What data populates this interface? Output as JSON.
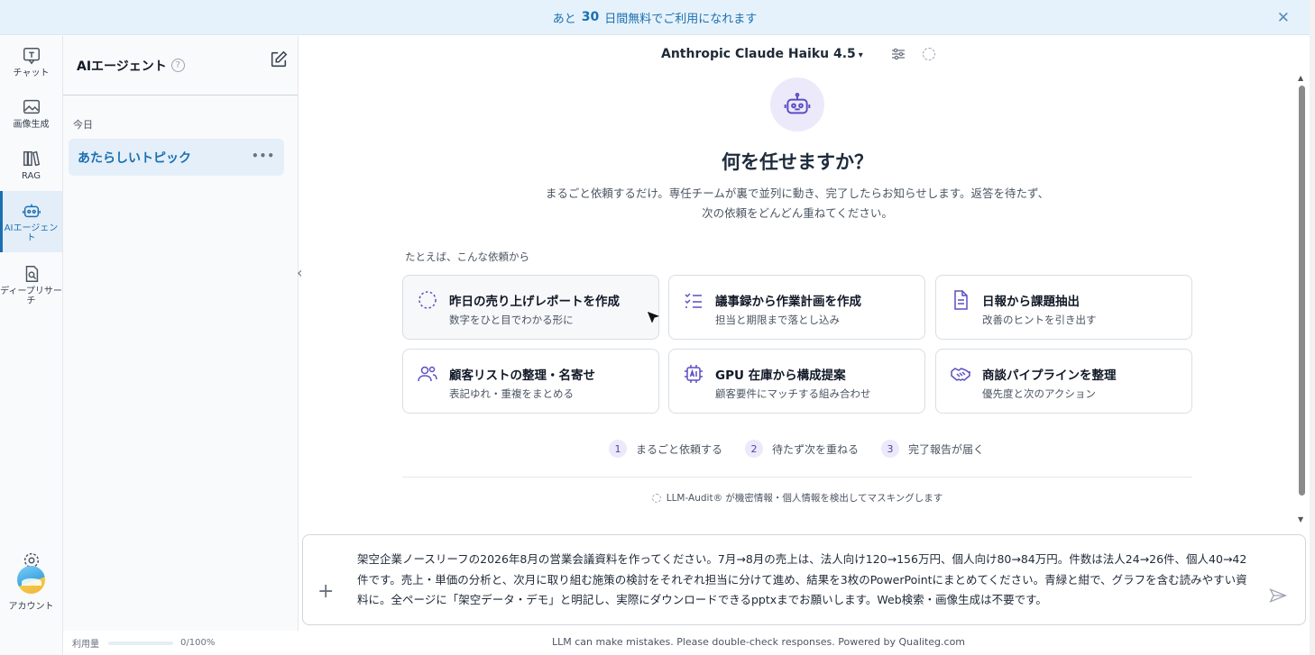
{
  "banner": {
    "prefix": "あと",
    "days": "30",
    "suffix": "日間無料でご利用になれます",
    "close": "✕"
  },
  "rail": {
    "items": [
      {
        "label": "チャット",
        "icon": "chat-icon"
      },
      {
        "label": "画像生成",
        "icon": "image-icon"
      },
      {
        "label": "RAG",
        "icon": "books-icon"
      },
      {
        "label": "AIエージェント",
        "icon": "robot-icon",
        "active": true
      },
      {
        "label": "ディープリサーチ",
        "icon": "doc-search-icon"
      }
    ],
    "settings_label": "設定",
    "account_label": "アカウント"
  },
  "sidebar": {
    "title": "AIエージェント",
    "help": "?",
    "section_today": "今日",
    "topics": [
      {
        "label": "あたらしいトピック",
        "menu": "•••"
      }
    ],
    "usage_label": "利用量",
    "usage_value": "0/100%"
  },
  "main": {
    "model_name": "Anthropic Claude Haiku 4.5",
    "caret": "▾",
    "hero_title": "何を任せますか？",
    "hero_subtitle": "まるごと依頼するだけ。専任チームが裏で並列に動き、完了したらお知らせします。返答を待たず、次の依頼をどんどん重ねてください。",
    "examples_label": "たとえば、こんな依頼から",
    "cards": [
      {
        "title": "昨日の売り上げレポートを作成",
        "subtitle": "数字をひと目でわかる形に",
        "icon": "loading-circle-icon"
      },
      {
        "title": "議事録から作業計画を作成",
        "subtitle": "担当と期限まで落とし込み",
        "icon": "checklist-icon"
      },
      {
        "title": "日報から課題抽出",
        "subtitle": "改善のヒントを引き出す",
        "icon": "document-icon"
      },
      {
        "title": "顧客リストの整理・名寄せ",
        "subtitle": "表記ゆれ・重複をまとめる",
        "icon": "users-icon"
      },
      {
        "title": "GPU 在庫から構成提案",
        "subtitle": "顧客要件にマッチする組み合わせ",
        "icon": "ai-chip-icon"
      },
      {
        "title": "商談パイプラインを整理",
        "subtitle": "優先度と次のアクション",
        "icon": "handshake-icon"
      }
    ],
    "steps": [
      {
        "num": "1",
        "label": "まるごと依頼する"
      },
      {
        "num": "2",
        "label": "待たず次を重ねる"
      },
      {
        "num": "3",
        "label": "完了報告が届く"
      }
    ],
    "audit_text": "LLM-Audit® が機密情報・個人情報を検出してマスキングします",
    "composer_text": "架空企業ノースリーフの2026年8月の営業会議資料を作ってください。7月→8月の売上は、法人向け120→156万円、個人向け80→84万円。件数は法人24→26件、個人40→42件です。売上・単価の分析と、次月に取り組む施策の検討をそれぞれ担当に分けて進め、結果を3枚のPowerPointにまとめてください。青緑と紺で、グラフを含む読みやすい資料に。全ページに「架空データ・デモ」と明記し、実際にダウンロードできるpptxまでお願いします。Web検索・画像生成は不要です。",
    "plus": "+",
    "footer": "LLM can make mistakes. Please double-check responses. Powered by Qualiteg.com"
  }
}
